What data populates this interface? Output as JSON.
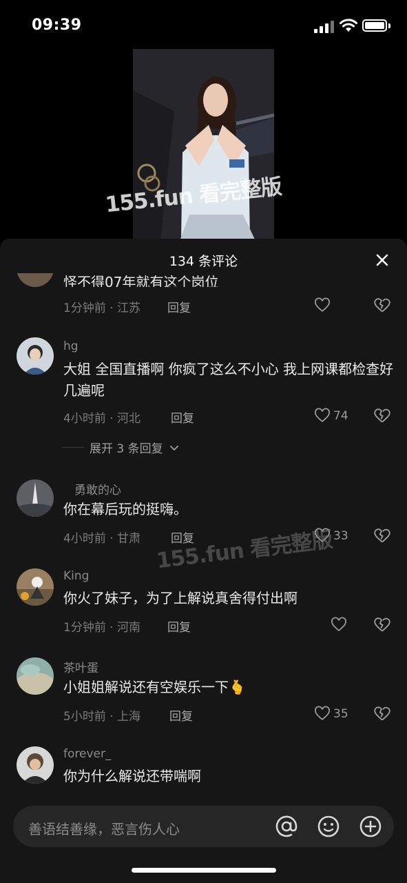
{
  "status_bar": {
    "time": "09:39"
  },
  "video": {
    "watermark": "155.fun 看完整版"
  },
  "comments_panel": {
    "title": "134 条评论",
    "comments": [
      {
        "text": "怪不得07年就有这个岗位",
        "meta": "1分钟前 · 江苏",
        "reply": "回复",
        "likes": ""
      },
      {
        "username": "hg",
        "text": "大姐 全国直播啊 你疯了这么不小心 我上网课都检查好几遍呢",
        "meta": "4小时前 · 河北",
        "reply": "回复",
        "likes": "74",
        "expand": "展开 3 条回复"
      },
      {
        "username": "勇敢的心",
        "text": "你在幕后玩的挺嗨。",
        "meta": "4小时前 · 甘肃",
        "reply": "回复",
        "likes": "33"
      },
      {
        "username": "King",
        "text": "你火了妹子，为了上解说真舍得付出啊",
        "meta": "1分钟前 · 河南",
        "reply": "回复",
        "likes": ""
      },
      {
        "username": "茶叶蛋",
        "text": "小姐姐解说还有空娱乐一下🫰",
        "meta": "5小时前 · 上海",
        "reply": "回复",
        "likes": "35"
      },
      {
        "username": "forever_",
        "text": "你为什么解说还带喘啊"
      }
    ]
  },
  "input_bar": {
    "placeholder": "善语结善缘，恶言伤人心"
  },
  "icons": {
    "close": "close-icon",
    "heart": "heart-icon",
    "broken_heart": "broken-heart-icon",
    "at": "at-icon",
    "emoji": "emoji-icon",
    "add": "plus-circle-icon",
    "chevron": "chevron-down-icon"
  },
  "colors": {
    "sheet_bg": "#161616",
    "input_bg": "#262626",
    "text_primary": "#eaeaea",
    "text_secondary": "#7b7b7b"
  }
}
